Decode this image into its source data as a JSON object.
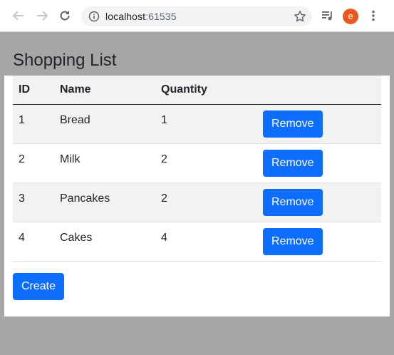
{
  "browser": {
    "url_host": "localhost",
    "url_port": ":61535",
    "profile_initial": "e"
  },
  "page": {
    "title": "Shopping List",
    "columns": [
      "ID",
      "Name",
      "Quantity"
    ],
    "items": [
      {
        "id": "1",
        "name": "Bread",
        "quantity": "1",
        "action": "Remove"
      },
      {
        "id": "2",
        "name": "Milk",
        "quantity": "2",
        "action": "Remove"
      },
      {
        "id": "3",
        "name": "Pancakes",
        "quantity": "2",
        "action": "Remove"
      },
      {
        "id": "4",
        "name": "Cakes",
        "quantity": "4",
        "action": "Remove"
      }
    ],
    "create_label": "Create"
  },
  "colors": {
    "primary": "#0d6efd",
    "page_background": "#a6a6a6",
    "avatar": "#e8581f"
  }
}
